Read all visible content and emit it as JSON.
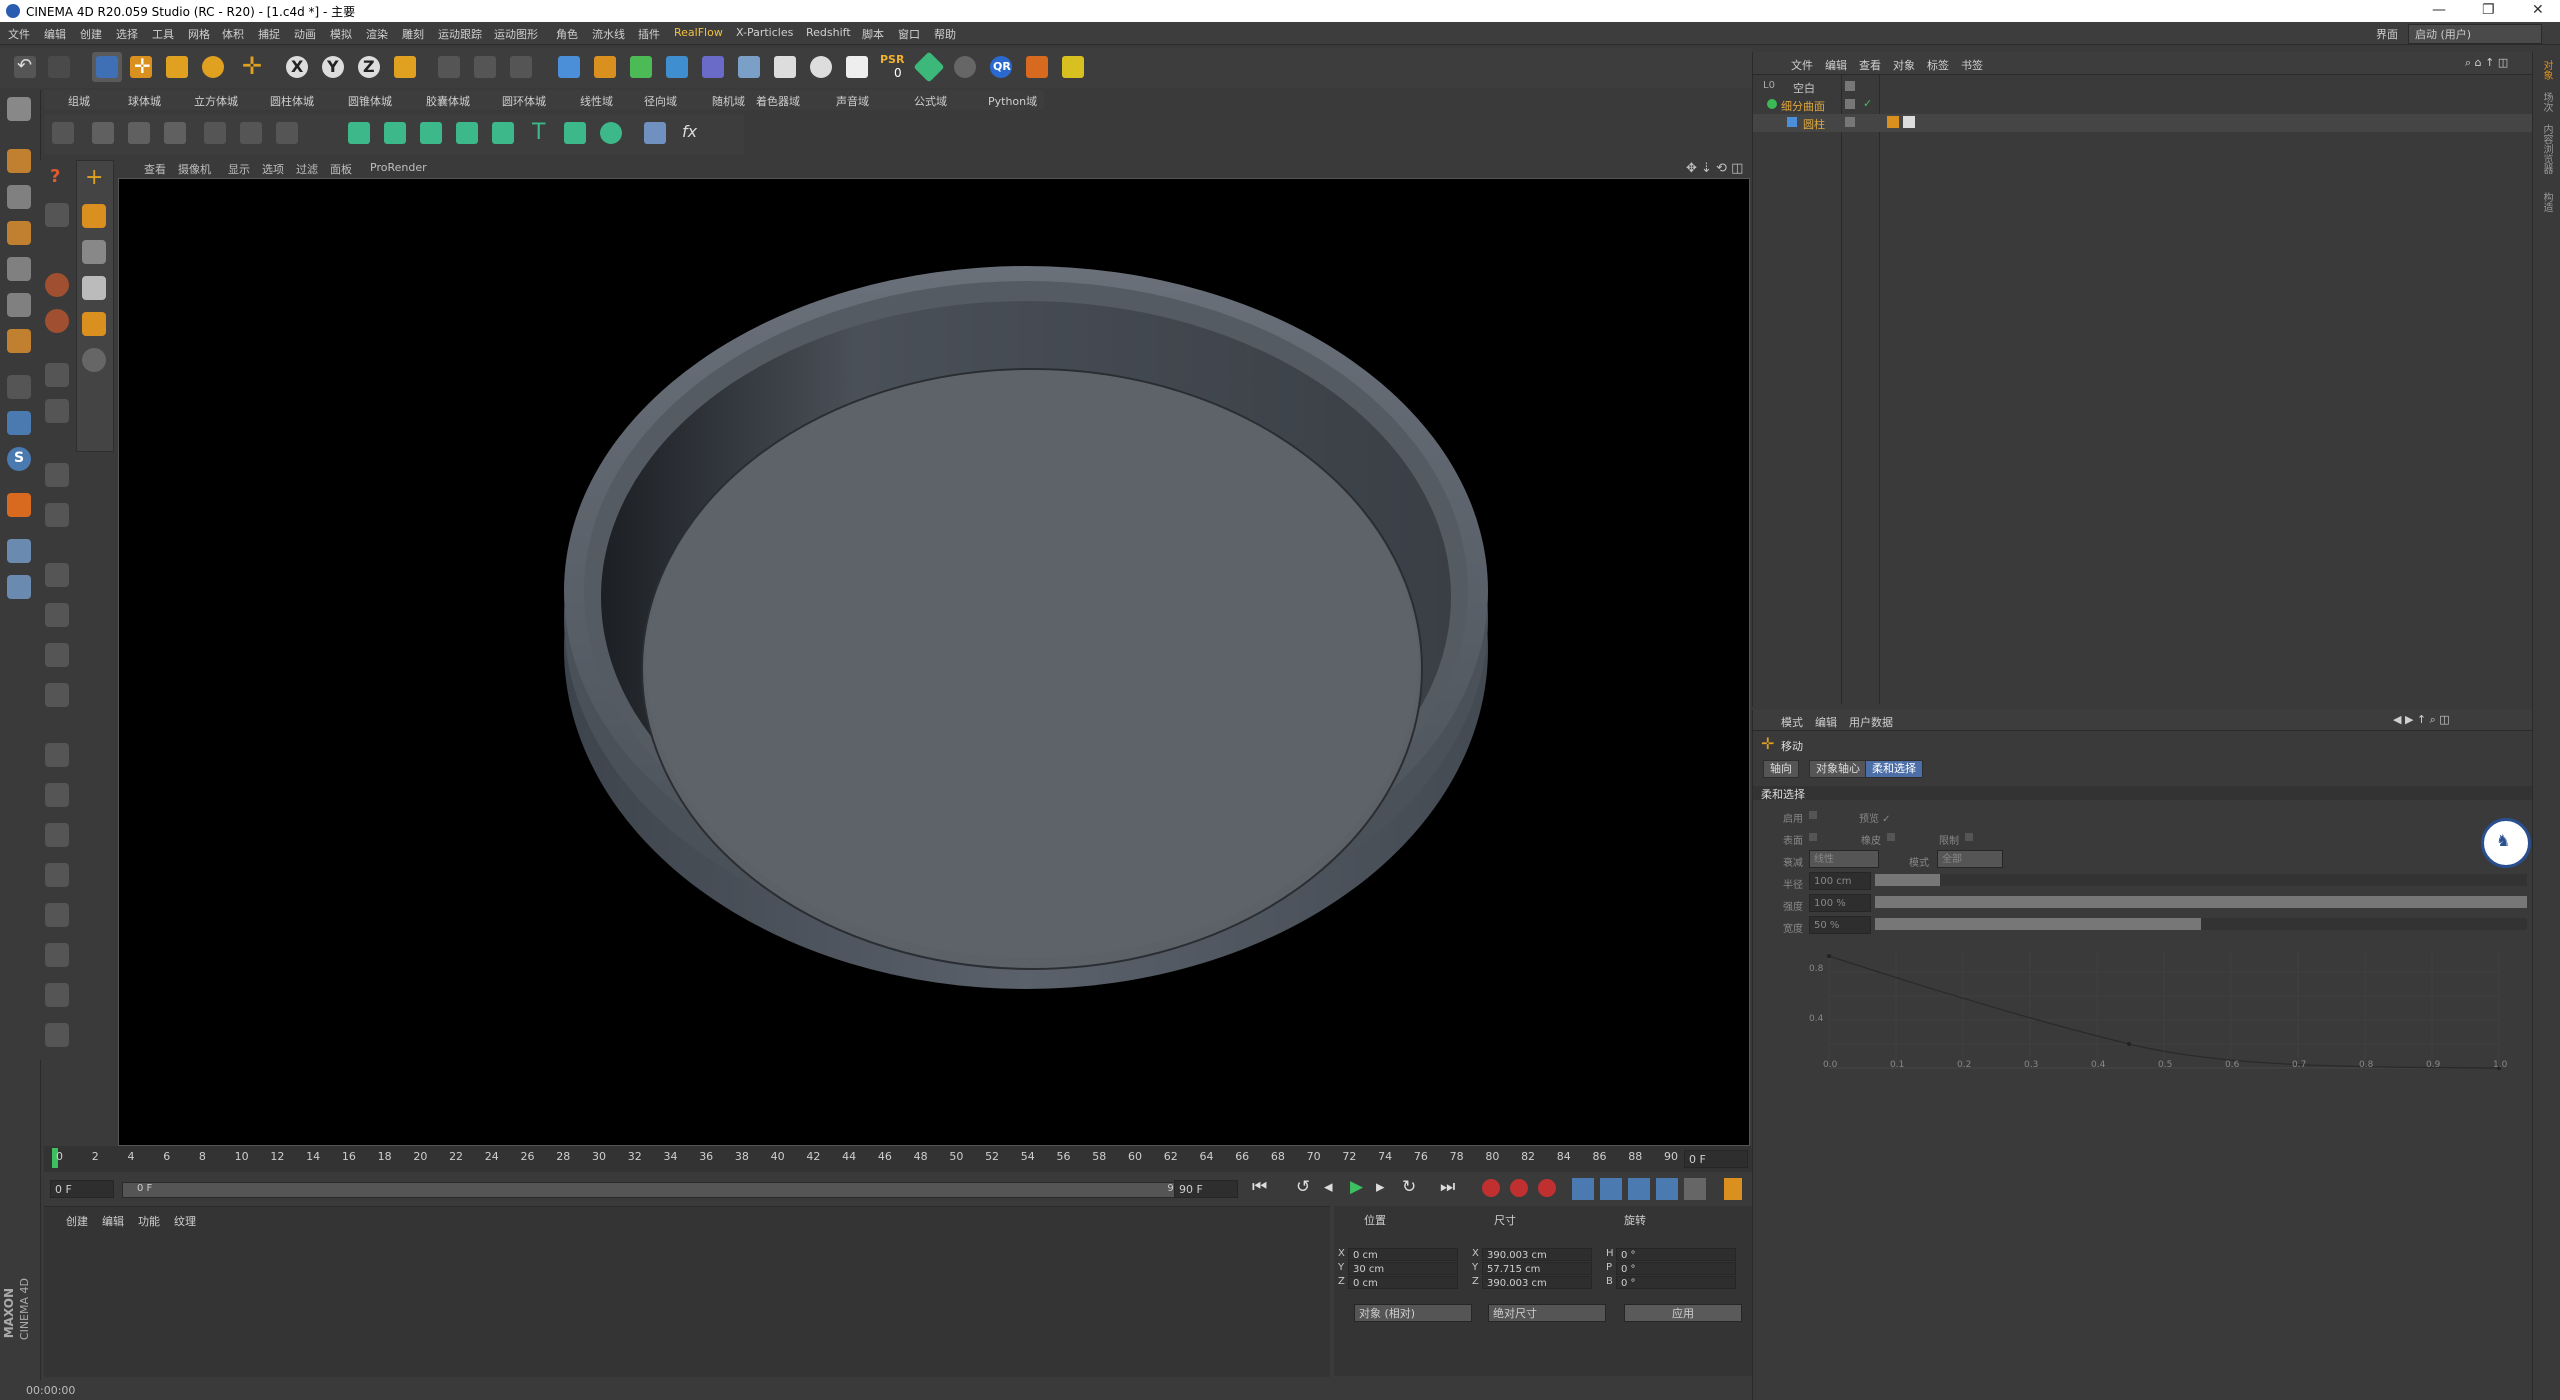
{
  "window": {
    "title": "CINEMA 4D R20.059 Studio (RC - R20) - [1.c4d *] - 主要",
    "controls": [
      "—",
      "❐",
      "✕"
    ]
  },
  "menu": {
    "items": [
      "文件",
      "编辑",
      "创建",
      "选择",
      "工具",
      "网格",
      "体积",
      "捕捉",
      "动画",
      "模拟",
      "渲染",
      "雕刻",
      "运动跟踪",
      "运动图形",
      "角色",
      "流水线",
      "插件",
      "RealFlow",
      "X-Particles",
      "Redshift",
      "脚本",
      "窗口",
      "帮助"
    ],
    "layout_label": "界面",
    "layout_value": "启动 (用户)"
  },
  "toolbar": {
    "psr_label": "PSR",
    "psr_value": "0",
    "qr_label": "QR",
    "axis": [
      "X",
      "Y",
      "Z"
    ]
  },
  "shelf": {
    "items": [
      "组城",
      "球体城",
      "立方体城",
      "圆柱体城",
      "圆锥体城",
      "胶囊体城",
      "圆环体城",
      "线性域",
      "径向域",
      "随机域",
      "着色器域",
      "声音域",
      "公式域",
      "Python域"
    ]
  },
  "viewport": {
    "menu": [
      "查看",
      "摄像机",
      "显示",
      "选项",
      "过滤",
      "面板",
      "ProRender"
    ]
  },
  "timeline": {
    "ticks": [
      "0",
      "2",
      "4",
      "6",
      "8",
      "10",
      "12",
      "14",
      "16",
      "18",
      "20",
      "22",
      "24",
      "26",
      "28",
      "30",
      "32",
      "34",
      "36",
      "38",
      "40",
      "42",
      "44",
      "46",
      "48",
      "50",
      "52",
      "54",
      "56",
      "58",
      "60",
      "62",
      "64",
      "66",
      "68",
      "70",
      "72",
      "74",
      "76",
      "78",
      "80",
      "82",
      "84",
      "86",
      "88",
      "90"
    ],
    "current_frame_display": "0 F",
    "start_frame": "0 F",
    "range_start": "0 F",
    "range_end": "90 F",
    "end_frame": "90 F"
  },
  "material_panel": {
    "menu": [
      "创建",
      "编辑",
      "功能",
      "纹理"
    ]
  },
  "coords": {
    "headers": [
      "位置",
      "尺寸",
      "旋转"
    ],
    "rows": [
      {
        "axis": "X",
        "pos": "0 cm",
        "size_axis": "X",
        "size": "390.003 cm",
        "rot_axis": "H",
        "rot": "0 °"
      },
      {
        "axis": "Y",
        "pos": "30 cm",
        "size_axis": "Y",
        "size": "57.715 cm",
        "rot_axis": "P",
        "rot": "0 °"
      },
      {
        "axis": "Z",
        "pos": "0 cm",
        "size_axis": "Z",
        "size": "390.003 cm",
        "rot_axis": "B",
        "rot": "0 °"
      }
    ],
    "mode1": "对象 (相对)",
    "mode2": "绝对尺寸",
    "apply": "应用"
  },
  "status": {
    "time": "00:00:00"
  },
  "object_manager": {
    "menu": [
      "文件",
      "编辑",
      "查看",
      "对象",
      "标签",
      "书签"
    ],
    "objects": [
      {
        "name": "空白",
        "color": "#c8c8c8"
      },
      {
        "name": "细分曲面",
        "color": "#e0a83a"
      },
      {
        "name": "圆柱",
        "color": "#e0a83a"
      }
    ]
  },
  "attribute_manager": {
    "menu": [
      "模式",
      "编辑",
      "用户数据"
    ],
    "tool_name": "移动",
    "tabs": [
      "轴向",
      "对象轴心",
      "柔和选择"
    ],
    "section": "柔和选择",
    "fields": {
      "enable": "启用",
      "preview": "预览 ✓",
      "surface": "表面",
      "rubber": "橡皮",
      "restrict": "限制",
      "falloff_label": "衰减",
      "falloff_value": "线性",
      "mode_label": "模式",
      "mode_value": "全部",
      "radius_label": "半径",
      "radius_value": "100 cm",
      "strength_label": "强度",
      "strength_value": "100 %",
      "width_label": "宽度",
      "width_value": "50 %"
    },
    "graph": {
      "x_ticks": [
        "0.0",
        "0.1",
        "0.2",
        "0.3",
        "0.4",
        "0.5",
        "0.6",
        "0.7",
        "0.8",
        "0.9",
        "1.0"
      ],
      "y_ticks": [
        "0.8",
        "0.4"
      ]
    }
  },
  "logo": {
    "line1": "MAXON",
    "line2": "CINEMA 4D"
  },
  "right_tabs": [
    "对象",
    "场次",
    "内容浏览器",
    "构造"
  ]
}
